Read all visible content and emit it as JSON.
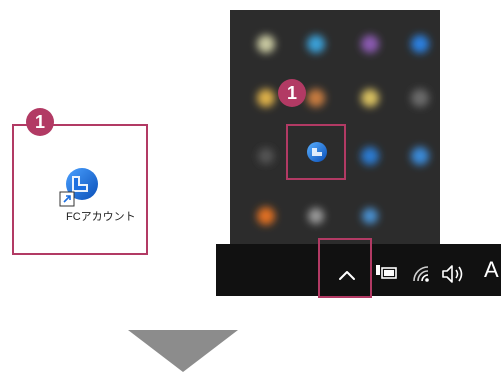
{
  "desktop": {
    "step_badge": "1",
    "shortcut_label": "FCアカウント",
    "shortcut_icon": "fc-account-icon"
  },
  "tray": {
    "step_badge": "1",
    "chevron_label": "^",
    "language_indicator": "A",
    "icons": [
      "battery-icon",
      "wifi-icon",
      "volume-icon"
    ]
  },
  "colors": {
    "accent": "#b23a64",
    "taskbar": "#111111",
    "flyout": "#2c2c2c",
    "arrow": "#8c8c8c"
  }
}
